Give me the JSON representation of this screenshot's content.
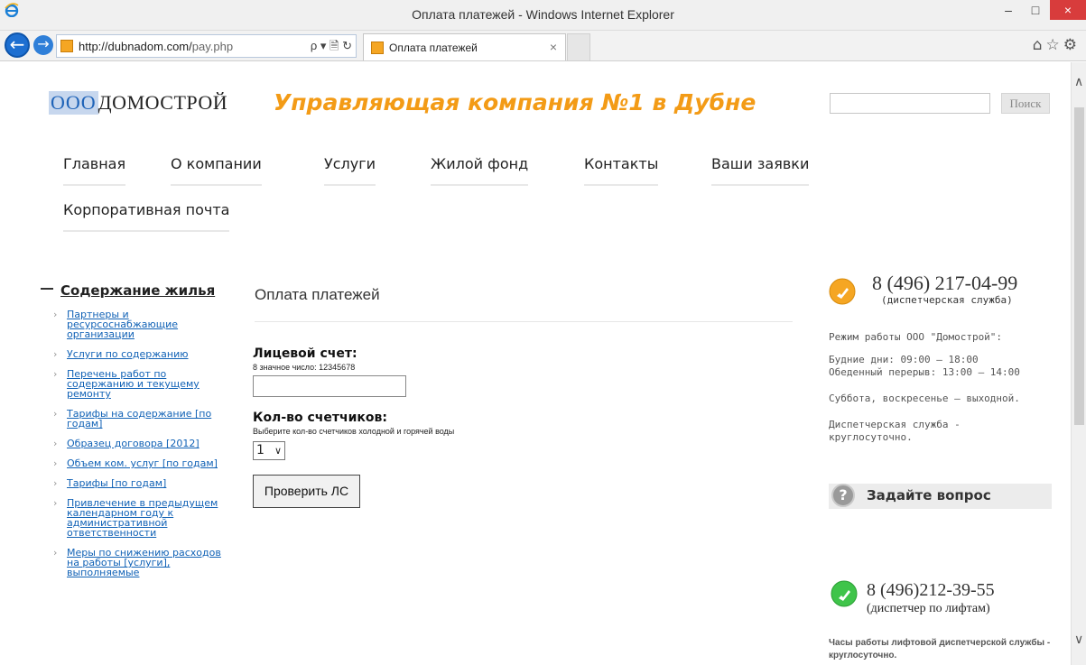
{
  "window": {
    "title": "Оплата платежей - Windows Internet Explorer",
    "minimize": "–",
    "maximize": "□",
    "close": "×"
  },
  "browser": {
    "url_host": "http://dubnadom.com/",
    "url_path": "pay.php",
    "address_tools": "ρ ▾ 🗎 ↻",
    "tab_title": "Оплата платежей",
    "tab_close": "×",
    "back_glyph": "←",
    "forward_glyph": "→",
    "toolbar_icons": "⌂☆⚙"
  },
  "header": {
    "logo_prefix": "ООО",
    "logo_name": " ДОМОСТРОЙ",
    "company_title": "Управляющая компания №1 в Дубне",
    "search_button": "Поиск"
  },
  "menu": [
    "Главная",
    "О компании",
    "Услуги",
    "Жилой фонд",
    "Контакты",
    "Ваши заявки",
    "Корпоративная почта"
  ],
  "sidebar": {
    "title": "Содержание жилья",
    "items": [
      "Партнеры и ресурсоснабжающие организации",
      "Услуги по содержанию",
      "Перечень работ по содержанию и текущему ремонту",
      "Тарифы на содержание [по годам]",
      "Образец договора [2012]",
      "Объем ком. услуг [по годам]",
      "Тарифы [по годам]",
      "Привлечение в предыдущем календарном году к административной ответственности",
      "Меры по снижению расходов на работы [услуги], выполняемые"
    ]
  },
  "main": {
    "title": "Оплата платежей",
    "account_label": "Лицевой счет:",
    "account_hint": "8 значное число: 12345678",
    "account_value": "",
    "meters_label": "Кол-во счетчиков:",
    "meters_hint": "Выберите кол-во счетчиков холодной и горячей воды",
    "meters_value": "1",
    "check_button": "Проверить ЛС"
  },
  "right": {
    "dispatch_phone": "8 (496) 217-04-99",
    "dispatch_sub": "(диспетчерская служба)",
    "hours_title": "Режим работы ООО \"Домострой\":",
    "weekdays": "Будние дни: 09:00 — 18:00",
    "lunch": "Обеденный перерыв: 13:00 — 14:00",
    "weekend": "Суббота, воскресенье — выходной.",
    "dispatch_hours": "Диспетчерская служба - круглосуточно.",
    "ask_label": "Задайте вопрос",
    "ask_glyph": "?",
    "lift_phone": "8 (496)212-39-55",
    "lift_sub": "(диспетчер по лифтам)",
    "lift_hours": "Часы работы лифтовой диспетчерской службы - круглосуточно."
  },
  "colors": {
    "accent_orange": "#f39b16",
    "link_blue": "#1162b6",
    "phone_orange": "#f5a623",
    "phone_green": "#3fc44a"
  }
}
